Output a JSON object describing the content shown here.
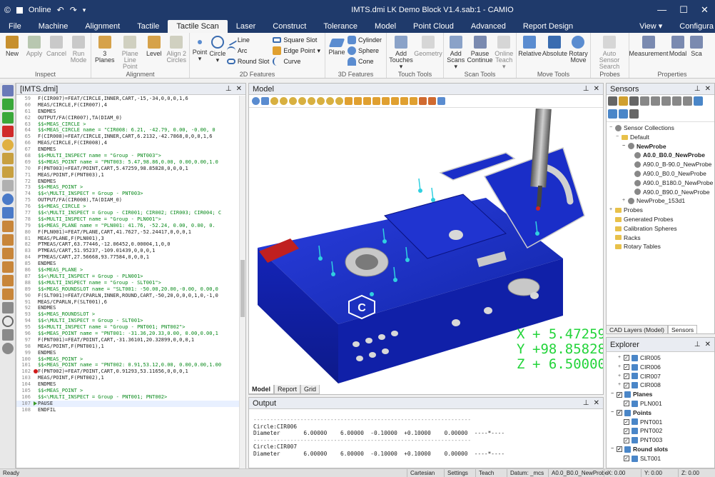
{
  "titlebar": {
    "online_label": "Online",
    "title": "IMTS.dmi  LK Demo Block V1.4.sab:1 - CAMIO",
    "minimize": "—",
    "maximize": "☐",
    "close": "✕"
  },
  "menu": {
    "tabs": [
      "File",
      "Machine",
      "Alignment",
      "Tactile",
      "Tactile Scan",
      "Laser",
      "Construct",
      "Tolerance",
      "Model",
      "Point Cloud",
      "Advanced",
      "Report Design"
    ],
    "active_index": 4,
    "view_label": "View",
    "configure_label": "Configura"
  },
  "ribbon": {
    "inspect": {
      "name": "Inspect",
      "new": "New",
      "apply": "Apply",
      "cancel": "Cancel",
      "run_mode": "Run Mode"
    },
    "alignment": {
      "name": "Alignment",
      "three_planes": "3 Planes",
      "plane_line_point": "Plane Line Point",
      "level": "Level",
      "align_2_circles": "Align 2 Circles"
    },
    "features_2d": {
      "name": "2D Features",
      "point": "Point",
      "circle": "Circle",
      "line": "Line",
      "arc": "Arc",
      "round_slot": "Round Slot",
      "square_slot": "Square Slot",
      "edge_point": "Edge Point",
      "curve": "Curve"
    },
    "features_3d": {
      "name": "3D Features",
      "plane": "Plane",
      "cylinder": "Cylinder",
      "sphere": "Sphere",
      "cone": "Cone"
    },
    "touch_tools": {
      "name": "Touch Tools",
      "add_touches": "Add Touches",
      "geometry": "Geometry"
    },
    "scan_tools": {
      "name": "Scan Tools",
      "add_scans": "Add Scans",
      "pause_continue": "Pause Continue",
      "online_teach": "Online Teach"
    },
    "move_tools": {
      "name": "Move Tools",
      "relative": "Relative",
      "absolute": "Absolute",
      "rotary_move": "Rotary Move"
    },
    "probes": {
      "name": "Probes",
      "auto_sensor_search": "Auto Sensor Search"
    },
    "properties": {
      "name": "Properties",
      "measurement": "Measurement",
      "modal": "Modal",
      "scan": "Sca"
    }
  },
  "editor": {
    "title": "[IMTS.dmi]",
    "lines": [
      {
        "n": "59",
        "t": "F(CIR007)=FEAT/CIRCLE,INNER,CART,-15,-34,0,0,0,1,6",
        "c": false
      },
      {
        "n": "60",
        "t": "MEAS/CIRCLE,F(CIR007),4",
        "c": false
      },
      {
        "n": "61",
        "t": "ENDMES",
        "c": false
      },
      {
        "n": "62",
        "t": "OUTPUT/FA(CIR007),TA(DIAM_0)",
        "c": false
      },
      {
        "n": "63",
        "t": "$$<MEAS_CIRCLE >",
        "c": true
      },
      {
        "n": "64",
        "t": "$$<MEAS_CIRCLE name = \"CIR008: 6.21, -42.79, 0.00,  -0.00, 0",
        "c": true
      },
      {
        "n": "65",
        "t": "F(CIR008)=FEAT/CIRCLE,INNER,CART,6.2132,-42.7868,0,0,0,1,6",
        "c": false
      },
      {
        "n": "66",
        "t": "MEAS/CIRCLE,F(CIR008),4",
        "c": false
      },
      {
        "n": "67",
        "t": "ENDMES",
        "c": false
      },
      {
        "n": "68",
        "t": "$$<MULTI_INSPECT name = \"Group - PNT003\">",
        "c": true
      },
      {
        "n": "69",
        "t": "$$<MEAS_POINT name = \"PNT003: 5.47,98.86,0.00, 0.00,0.00,1.0",
        "c": true
      },
      {
        "n": "70",
        "t": "F(PNT003)=FEAT/POINT,CART,5.47259,98.85828,0,0,0,1",
        "c": false
      },
      {
        "n": "71",
        "t": "MEAS/POINT,F(PNT003),1",
        "c": false
      },
      {
        "n": "72",
        "t": "ENDMES",
        "c": false
      },
      {
        "n": "73",
        "t": "$$<MEAS_POINT >",
        "c": true
      },
      {
        "n": "74",
        "t": "$$<\\MULTI_INSPECT = Group - PNT003>",
        "c": true
      },
      {
        "n": "75",
        "t": "OUTPUT/FA(CIR008),TA(DIAM_0)",
        "c": false
      },
      {
        "n": "76",
        "t": "$$<MEAS_CIRCLE >",
        "c": true
      },
      {
        "n": "77",
        "t": "$$<\\MULTI_INSPECT = Group - CIR001; CIR002; CIR003; CIR004; C",
        "c": true
      },
      {
        "n": "78",
        "t": "$$<MULTI_INSPECT name = \"Group - PLN001\">",
        "c": true
      },
      {
        "n": "79",
        "t": "$$<MEAS_PLANE name = \"PLN001:  41.76, -52.24, 0.00, 0.00, 0.",
        "c": true
      },
      {
        "n": "80",
        "t": "F(PLN001)=FEAT/PLANE,CART,41.7627,-52.24417,0,0,0,1",
        "c": false
      },
      {
        "n": "81",
        "t": "MEAS/PLANE,F(PLN001),3",
        "c": false
      },
      {
        "n": "82",
        "t": "PTMEAS/CART,63.77446,-12.06452,0.00004,1,0,0",
        "c": false
      },
      {
        "n": "83",
        "t": "PTMEAS/CART,51.95237,-109.01439,0,0,0,1",
        "c": false
      },
      {
        "n": "84",
        "t": "PTMEAS/CART,27.56668,93.77584,0,0,0,1",
        "c": false
      },
      {
        "n": "85",
        "t": "ENDMES",
        "c": false
      },
      {
        "n": "86",
        "t": "$$<MEAS_PLANE >",
        "c": true
      },
      {
        "n": "87",
        "t": "$$<\\MULTI_INSPECT = Group - PLN001>",
        "c": true
      },
      {
        "n": "88",
        "t": "$$<MULTI_INSPECT name = \"Group - SLT001\">",
        "c": true
      },
      {
        "n": "89",
        "t": "$$<MEAS_ROUNDSLOT name = \"SLT001: -50.00,20.00,-0.00, 0.00,0",
        "c": true
      },
      {
        "n": "90",
        "t": "F(SLT001)=FEAT/CPARLN,INNER,ROUND,CART,-50,20,0,0,0,1,0,-1,0",
        "c": false
      },
      {
        "n": "91",
        "t": "MEAS/CPARLN,F(SLT001),6",
        "c": false
      },
      {
        "n": "92",
        "t": "ENDMES",
        "c": false
      },
      {
        "n": "93",
        "t": "$$<MEAS_ROUNDSLOT >",
        "c": true
      },
      {
        "n": "94",
        "t": "$$<\\MULTI_INSPECT = Group - SLT001>",
        "c": true
      },
      {
        "n": "95",
        "t": "$$<MULTI_INSPECT name = \"Group - PNT001; PNT002\">",
        "c": true
      },
      {
        "n": "96",
        "t": "$$<MEAS_POINT name = \"PNT001: -31.36,20.33,0.00, 0.00,0.00,1",
        "c": true
      },
      {
        "n": "97",
        "t": "F(PNT001)=FEAT/POINT,CART,-31.36101,20.32899,0,0,0,1",
        "c": false
      },
      {
        "n": "98",
        "t": "MEAS/POINT,F(PNT001),1",
        "c": false
      },
      {
        "n": "99",
        "t": "ENDMES",
        "c": false
      },
      {
        "n": "100",
        "t": "$$<MEAS_POINT >",
        "c": true
      },
      {
        "n": "101",
        "t": "$$<MEAS_POINT name = \"PNT002: 0.91,53.12,0.00, 0.00,0.00,1.00",
        "c": true
      },
      {
        "n": "102",
        "t": "F(PNT002)=FEAT/POINT,CART,0.91293,53.11656,0,0,0,1",
        "c": false,
        "bp": true
      },
      {
        "n": "103",
        "t": "MEAS/POINT,F(PNT002),1",
        "c": false
      },
      {
        "n": "104",
        "t": "ENDMES",
        "c": false
      },
      {
        "n": "105",
        "t": "$$<MEAS_POINT >",
        "c": true
      },
      {
        "n": "106",
        "t": "$$<\\MULTI_INSPECT = Group - PNT001; PNT002>",
        "c": true
      },
      {
        "n": "107",
        "t": "PAUSE",
        "c": false,
        "cur": true
      },
      {
        "n": "108",
        "t": "ENDFIL",
        "c": false
      }
    ]
  },
  "model": {
    "title": "Model",
    "dro": {
      "x_label": "X",
      "x_value": "+ 5.47259",
      "y_label": "Y",
      "y_value": "+98.85828",
      "z_label": "Z",
      "z_value": "+ 6.50000"
    },
    "tabs": [
      "Model",
      "Report",
      "Grid"
    ],
    "active_tab": 0
  },
  "output": {
    "title": "Output",
    "dashes": "-----------------------------------------------------------------",
    "blocks": [
      {
        "name": "Circle:CIR006",
        "row": "Diameter       6.00000    6.00000  -0.10000  +0.10000    0.00000  ----*----"
      },
      {
        "name": "Circle:CIR007",
        "row": "Diameter       6.00000    6.00000  -0.10000  +0.10000    0.00000  ----*----"
      }
    ]
  },
  "sensors": {
    "title": "Sensors",
    "tree": [
      {
        "lv": 0,
        "icon": "p",
        "label": "Sensor Collections",
        "b": "−"
      },
      {
        "lv": 1,
        "icon": "f",
        "label": "Default",
        "b": "−"
      },
      {
        "lv": 2,
        "icon": "p",
        "label": "NewProbe",
        "b": "−",
        "bold": true
      },
      {
        "lv": 3,
        "icon": "p",
        "label": "A0.0_B0.0_NewProbe",
        "bold": true
      },
      {
        "lv": 3,
        "icon": "p",
        "label": "A90.0_B-90.0_NewProbe"
      },
      {
        "lv": 3,
        "icon": "p",
        "label": "A90.0_B0.0_NewProbe"
      },
      {
        "lv": 3,
        "icon": "p",
        "label": "A90.0_B180.0_NewProbe"
      },
      {
        "lv": 3,
        "icon": "p",
        "label": "A90.0_B90.0_NewProbe"
      },
      {
        "lv": 2,
        "icon": "p",
        "label": "NewProbe_153d1",
        "b": "+"
      },
      {
        "lv": 0,
        "icon": "f",
        "label": "Probes",
        "b": "+"
      },
      {
        "lv": 0,
        "icon": "f",
        "label": "Generated Probes"
      },
      {
        "lv": 0,
        "icon": "f",
        "label": "Calibration Spheres"
      },
      {
        "lv": 0,
        "icon": "f",
        "label": "Racks"
      },
      {
        "lv": 0,
        "icon": "f",
        "label": "Rotary Tables"
      }
    ],
    "tabs": [
      "CAD Layers (Model)",
      "Sensors"
    ],
    "active_tab": 1
  },
  "explorer": {
    "title": "Explorer",
    "tree": [
      {
        "lv": 1,
        "label": "CIR005",
        "b": "+"
      },
      {
        "lv": 1,
        "label": "CIR006",
        "b": "+"
      },
      {
        "lv": 1,
        "label": "CIR007",
        "b": "+"
      },
      {
        "lv": 1,
        "label": "CIR008",
        "b": "+"
      },
      {
        "lv": 0,
        "label": "Planes",
        "b": "−",
        "bold": true
      },
      {
        "lv": 1,
        "label": "PLN001"
      },
      {
        "lv": 0,
        "label": "Points",
        "b": "−",
        "bold": true
      },
      {
        "lv": 1,
        "label": "PNT001"
      },
      {
        "lv": 1,
        "label": "PNT002"
      },
      {
        "lv": 1,
        "label": "PNT003"
      },
      {
        "lv": 0,
        "label": "Round slots",
        "b": "−",
        "bold": true
      },
      {
        "lv": 1,
        "label": "SLT001"
      }
    ]
  },
  "status": {
    "ready": "Ready",
    "cartesian": "Cartesian",
    "settings": "Settings",
    "teach": "Teach",
    "datum": "Datum: _mcs",
    "probe": "A0.0_B0.0_NewProbe",
    "x": "X: 0.00",
    "y": "Y: 0.00",
    "z": "Z: 0.00"
  },
  "colors": {
    "brand": "#1f3a6b",
    "block": "#1226a8",
    "dro": "#23d43a",
    "comment": "#0a8a1c"
  }
}
